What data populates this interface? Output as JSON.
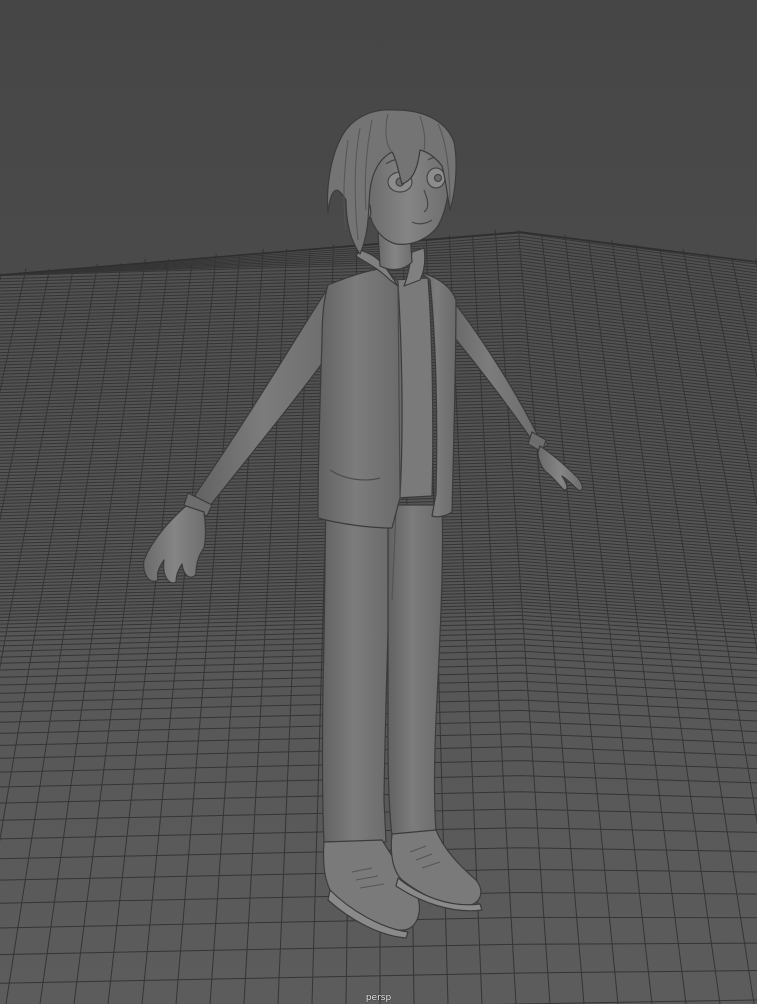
{
  "viewport": {
    "camera_name": "persp",
    "background_color": "#464646",
    "grid_color": "#353535",
    "model_color": "#777777"
  }
}
